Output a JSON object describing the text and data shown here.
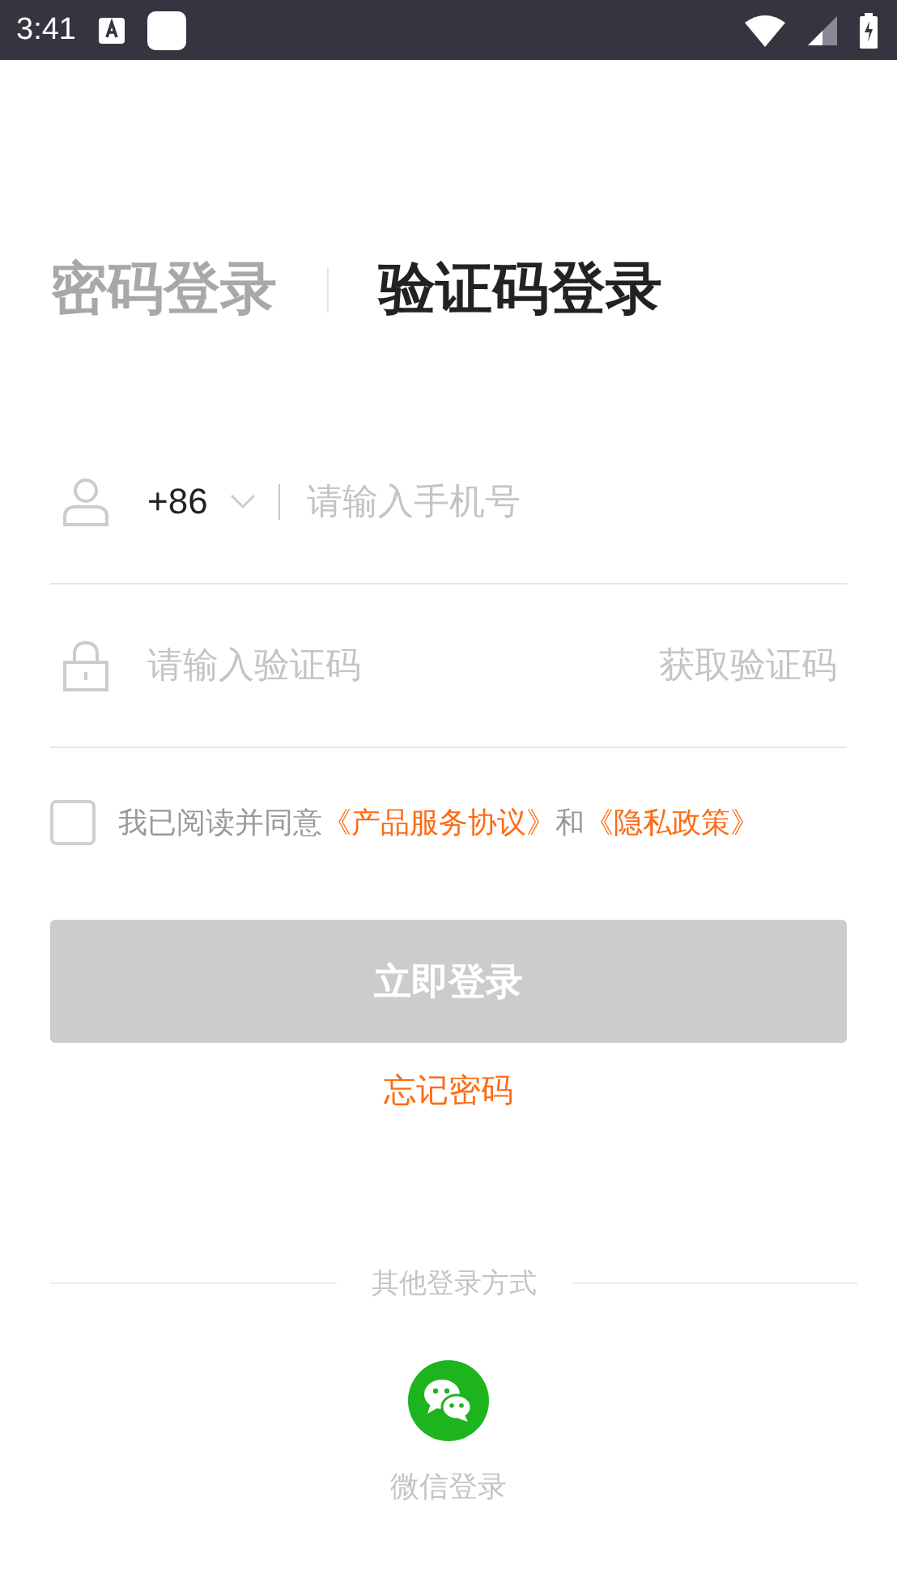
{
  "status_bar": {
    "time": "3:41"
  },
  "tabs": [
    {
      "label": "密码登录",
      "selected": false
    },
    {
      "label": "验证码登录",
      "selected": true
    }
  ],
  "phone": {
    "country_code": "+86",
    "placeholder": "请输入手机号"
  },
  "code": {
    "placeholder": "请输入验证码",
    "get_code": "获取验证码"
  },
  "agreement": {
    "checked": false,
    "parts": [
      {
        "kind": "text",
        "text": "我已阅读并同意"
      },
      {
        "kind": "link",
        "text": "《产品服务协议》"
      },
      {
        "kind": "text",
        "text": "和"
      },
      {
        "kind": "link",
        "text": "《隐私政策》"
      }
    ]
  },
  "login_button": {
    "label": "立即登录",
    "disabled": true
  },
  "forgot_password": "忘记密码",
  "other_methods": {
    "label": "其他登录方式",
    "items": [
      {
        "label": "微信登录"
      }
    ]
  }
}
